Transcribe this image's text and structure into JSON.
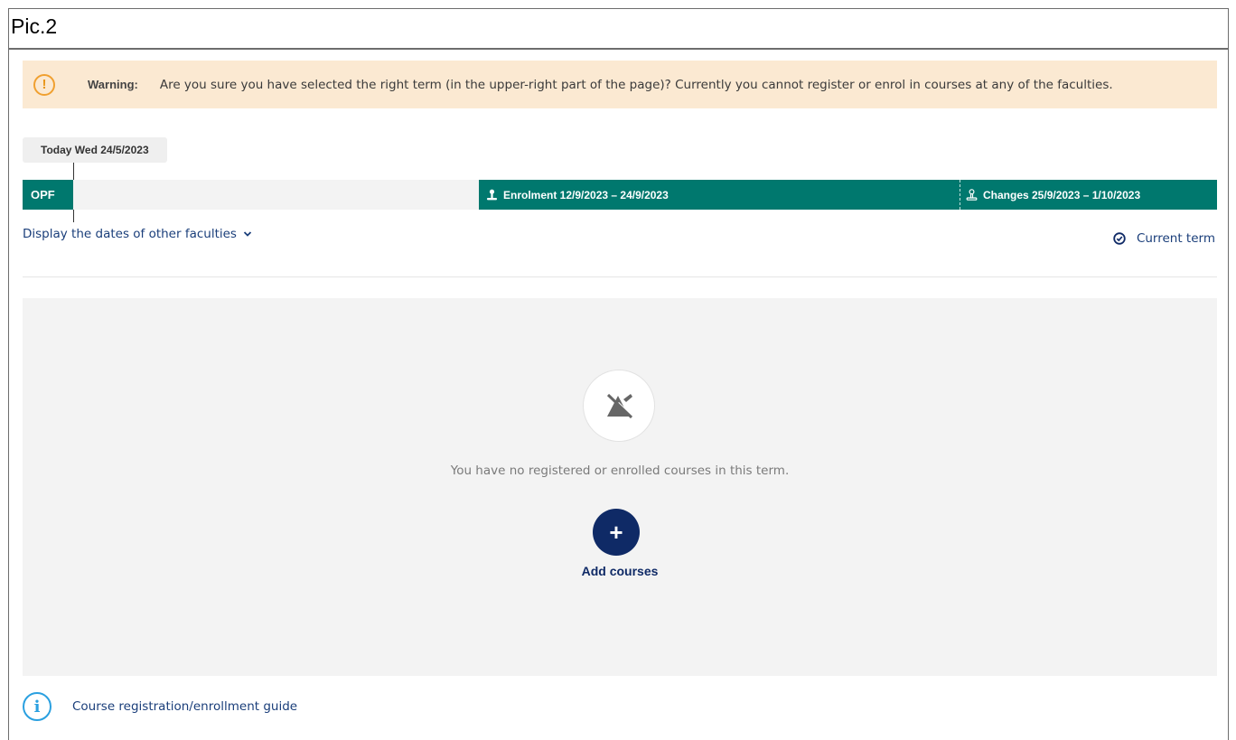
{
  "pic_title": "Pic.2",
  "warning": {
    "icon": "exclamation-icon",
    "label": "Warning:",
    "text": "Are you sure you have selected the right term (in the upper-right part of the page)? Currently you cannot register or enrol in courses at any of the faculties."
  },
  "today": "Today Wed 24/5/2023",
  "timeline": {
    "faculty": "OPF",
    "enrolment": "Enrolment 12/9/2023 – 24/9/2023",
    "changes": "Changes 25/9/2023 – 1/10/2023"
  },
  "links": {
    "display_dates": "Display the dates of other faculties",
    "current_term": "Current term"
  },
  "empty_state": {
    "message": "You have no registered or enrolled courses in this term.",
    "add_label": "Add courses",
    "add_symbol": "+"
  },
  "guide": {
    "label": "Course registration/enrollment guide"
  },
  "colors": {
    "teal": "#00786e",
    "navy": "#0f2a66",
    "warning_bg": "#fbe9d2",
    "info_blue": "#2aa0e0"
  }
}
